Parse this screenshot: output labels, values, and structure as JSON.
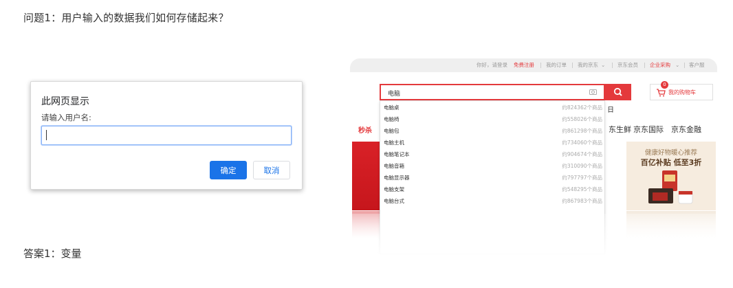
{
  "question": "问题1：用户输入的数据我们如何存储起来？",
  "answer": "答案1：变量",
  "dialog": {
    "title": "此网页显示",
    "message": "请输入用户名:",
    "input_value": "",
    "ok_label": "确定",
    "cancel_label": "取消",
    "accent_color": "#1a73e8"
  },
  "jd": {
    "topbar": {
      "greeting": "你好，请登录",
      "register": "免费注册",
      "orders": "我的订单",
      "myjd": "我的京东",
      "member": "京东会员",
      "enterprise": "企业采购",
      "service": "客户服"
    },
    "search": {
      "value": "电脑",
      "icon": "search-icon",
      "camera_icon": "camera-icon"
    },
    "cart": {
      "label": "我的购物车",
      "count": "0"
    },
    "suggestions": [
      {
        "term": "电脑桌",
        "count": "约824362个商品"
      },
      {
        "term": "电脑椅",
        "count": "约558026个商品"
      },
      {
        "term": "电脑包",
        "count": "约861298个商品"
      },
      {
        "term": "电脑主机",
        "count": "约734060个商品"
      },
      {
        "term": "电脑笔记本",
        "count": "约904674个商品"
      },
      {
        "term": "电脑音箱",
        "count": "约310090个商品"
      },
      {
        "term": "电脑显示器",
        "count": "约797797个商品"
      },
      {
        "term": "电脑支架",
        "count": "约548295个商品"
      },
      {
        "term": "电脑台式",
        "count": "约867983个商品"
      }
    ],
    "nav": {
      "first": "秒杀",
      "peek": "日",
      "items": [
        "东生鲜",
        "京东国际",
        "京东金融"
      ]
    },
    "ad": {
      "line1": "健康好物暖心推荐",
      "line2": "百亿补贴 低至3折"
    },
    "brand_color": "#e4393c"
  }
}
